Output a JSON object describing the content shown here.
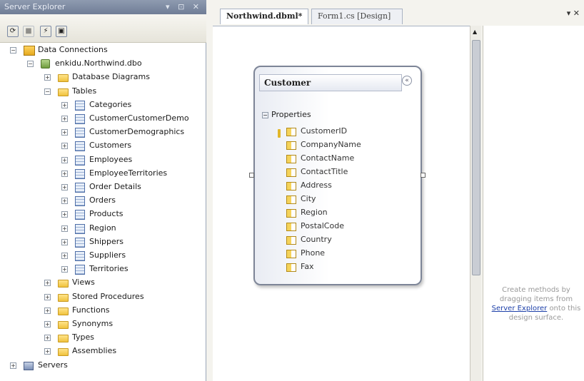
{
  "server_explorer": {
    "title": "Server Explorer",
    "title_buttons": "▾ ⊡ ✕",
    "tree": [
      {
        "label": "Data Connections",
        "level": 0,
        "expander": "−",
        "icon": "data-connections-icon"
      },
      {
        "label": "enkidu.Northwind.dbo",
        "level": 1,
        "expander": "−",
        "icon": "database-icon"
      },
      {
        "label": "Database Diagrams",
        "level": 2,
        "expander": "+",
        "icon": "folder-icon"
      },
      {
        "label": "Tables",
        "level": 2,
        "expander": "−",
        "icon": "folder-icon"
      },
      {
        "label": "Categories",
        "level": 3,
        "expander": "+",
        "icon": "table-icon"
      },
      {
        "label": "CustomerCustomerDemo",
        "level": 3,
        "expander": "+",
        "icon": "table-icon"
      },
      {
        "label": "CustomerDemographics",
        "level": 3,
        "expander": "+",
        "icon": "table-icon"
      },
      {
        "label": "Customers",
        "level": 3,
        "expander": "+",
        "icon": "table-icon"
      },
      {
        "label": "Employees",
        "level": 3,
        "expander": "+",
        "icon": "table-icon"
      },
      {
        "label": "EmployeeTerritories",
        "level": 3,
        "expander": "+",
        "icon": "table-icon"
      },
      {
        "label": "Order Details",
        "level": 3,
        "expander": "+",
        "icon": "table-icon"
      },
      {
        "label": "Orders",
        "level": 3,
        "expander": "+",
        "icon": "table-icon"
      },
      {
        "label": "Products",
        "level": 3,
        "expander": "+",
        "icon": "table-icon"
      },
      {
        "label": "Region",
        "level": 3,
        "expander": "+",
        "icon": "table-icon"
      },
      {
        "label": "Shippers",
        "level": 3,
        "expander": "+",
        "icon": "table-icon"
      },
      {
        "label": "Suppliers",
        "level": 3,
        "expander": "+",
        "icon": "table-icon"
      },
      {
        "label": "Territories",
        "level": 3,
        "expander": "+",
        "icon": "table-icon"
      },
      {
        "label": "Views",
        "level": 2,
        "expander": "+",
        "icon": "folder-icon"
      },
      {
        "label": "Stored Procedures",
        "level": 2,
        "expander": "+",
        "icon": "folder-icon"
      },
      {
        "label": "Functions",
        "level": 2,
        "expander": "+",
        "icon": "folder-icon"
      },
      {
        "label": "Synonyms",
        "level": 2,
        "expander": "+",
        "icon": "folder-icon"
      },
      {
        "label": "Types",
        "level": 2,
        "expander": "+",
        "icon": "folder-icon"
      },
      {
        "label": "Assemblies",
        "level": 2,
        "expander": "+",
        "icon": "folder-icon"
      },
      {
        "label": "Servers",
        "level": 0,
        "expander": "+",
        "icon": "servers-icon"
      }
    ]
  },
  "tabs": [
    {
      "label": "Northwind.dbml*",
      "active": true
    },
    {
      "label": "Form1.cs [Design]",
      "active": false
    }
  ],
  "tab_controls": "▾ ✕",
  "entity": {
    "name": "Customer",
    "section": "Properties",
    "properties": [
      {
        "name": "CustomerID",
        "primary_key": true
      },
      {
        "name": "CompanyName"
      },
      {
        "name": "ContactName"
      },
      {
        "name": "ContactTitle"
      },
      {
        "name": "Address"
      },
      {
        "name": "City"
      },
      {
        "name": "Region"
      },
      {
        "name": "PostalCode"
      },
      {
        "name": "Country"
      },
      {
        "name": "Phone"
      },
      {
        "name": "Fax"
      }
    ]
  },
  "methods_pane": {
    "text_before": "Create methods by dragging items from",
    "link": "Server Explorer",
    "text_after": "onto this design surface."
  },
  "colors": {
    "accent": "#1c3fa8",
    "title_bar": "#7a879e",
    "entity_border": "#7d8597"
  }
}
